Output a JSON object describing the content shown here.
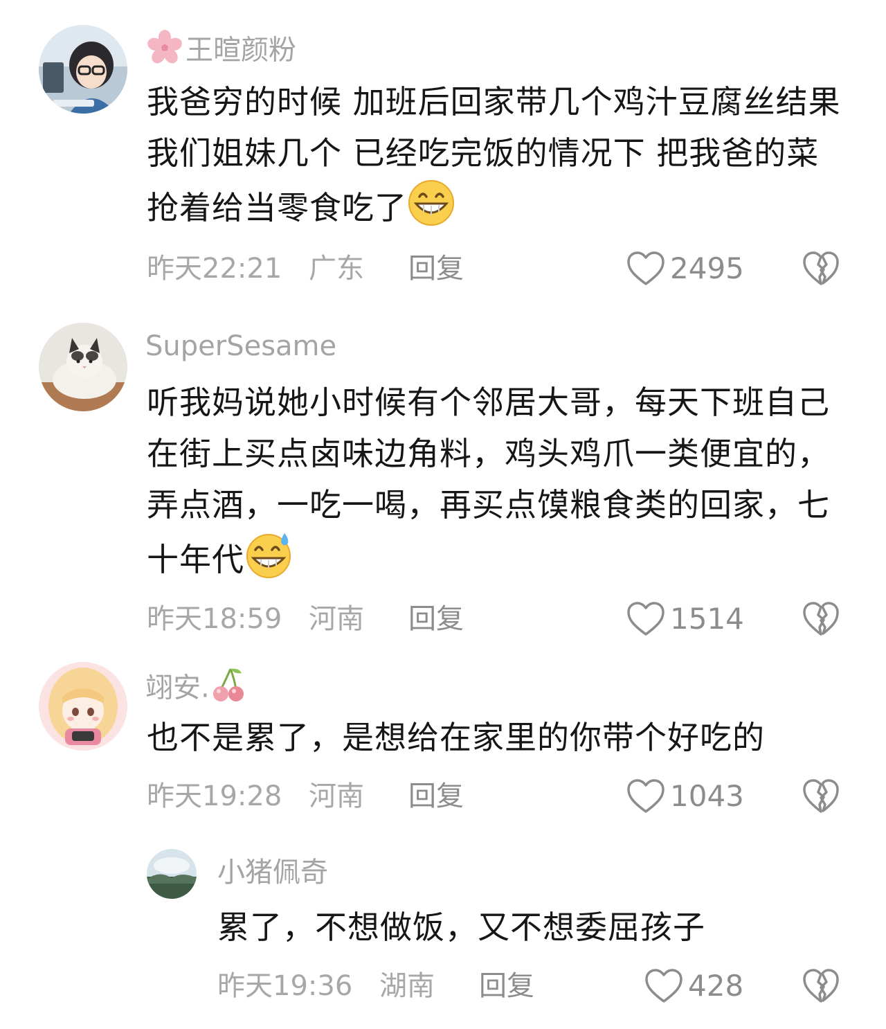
{
  "colors": {
    "text": "#161616",
    "muted": "#a4a4a4",
    "action": "#8c8c8c"
  },
  "comments": [
    {
      "username": "王暄颜粉",
      "username_prefix_icon": "cherry-blossom-icon",
      "text": "我爸穷的时候 加班后回家带几个鸡汁豆腐丝结果我们姐妹几个 已经吃完饭的情况下 把我爸的菜抢着给当零食吃了",
      "emoji": "grinning-face-icon",
      "time": "昨天22:21",
      "location": "广东",
      "reply_label": "回复",
      "likes": "2495"
    },
    {
      "username": "SuperSesame",
      "text": "听我妈说她小时候有个邻居大哥，每天下班自己在街上买点卤味边角料，鸡头鸡爪一类便宜的，弄点酒，一吃一喝，再买点馍粮食类的回家，七十年代",
      "emoji": "grinning-sweat-icon",
      "time": "昨天18:59",
      "location": "河南",
      "reply_label": "回复",
      "likes": "1514"
    },
    {
      "username": "翊安.",
      "username_suffix_icon": "cherries-icon",
      "text": "也不是累了，是想给在家里的你带个好吃的",
      "time": "昨天19:28",
      "location": "河南",
      "reply_label": "回复",
      "likes": "1043"
    },
    {
      "username": "小猪佩奇",
      "text": "累了，不想做饭，又不想委屈孩子",
      "time": "昨天19:36",
      "location": "湖南",
      "reply_label": "回复",
      "likes": "428"
    }
  ]
}
